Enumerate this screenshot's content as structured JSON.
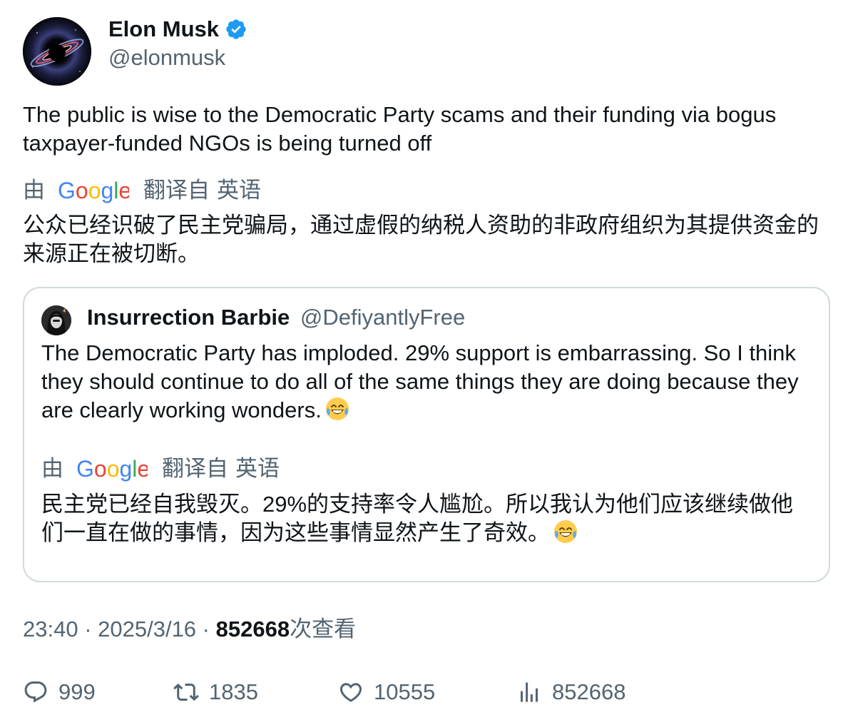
{
  "author": {
    "name": "Elon Musk",
    "handle": "@elonmusk",
    "verified": true
  },
  "tweet": {
    "text": "The public is wise to the Democratic Party scams and their funding via bogus taxpayer-funded NGOs is being turned off",
    "translation": {
      "by": "由",
      "provider": "Google",
      "from": "翻译自",
      "language": "英语",
      "text": "公众已经识破了民主党骗局，通过虚假的纳税人资助的非政府组织为其提供资金的来源正在被切断。"
    }
  },
  "quote": {
    "name": "Insurrection Barbie",
    "handle": "@DefiyantlyFree",
    "text": "The Democratic Party has imploded. 29% support is embarrassing. So I think they should continue to do all of the same things they are doing because they are clearly working wonders.",
    "translation": {
      "by": "由",
      "provider": "Google",
      "from": "翻译自",
      "language": "英语",
      "text": "民主党已经自我毁灭。29%的支持率令人尴尬。所以我认为他们应该继续做他们一直在做的事情，因为这些事情显然产生了奇效。"
    }
  },
  "meta": {
    "time": "23:40",
    "separator": " · ",
    "date": "2025/3/16",
    "views": "852668",
    "views_suffix": "次查看"
  },
  "actions": {
    "replies": "999",
    "retweets": "1835",
    "likes": "10555",
    "views": "852668"
  },
  "colors": {
    "text": "#0f1419",
    "secondary": "#536471",
    "border": "#cfd9de",
    "verified": "#1d9bf0"
  },
  "icons": [
    "verified-badge-icon",
    "google-logo-icon",
    "laughing-emoji-icon",
    "reply-icon",
    "retweet-icon",
    "like-icon",
    "views-icon"
  ]
}
